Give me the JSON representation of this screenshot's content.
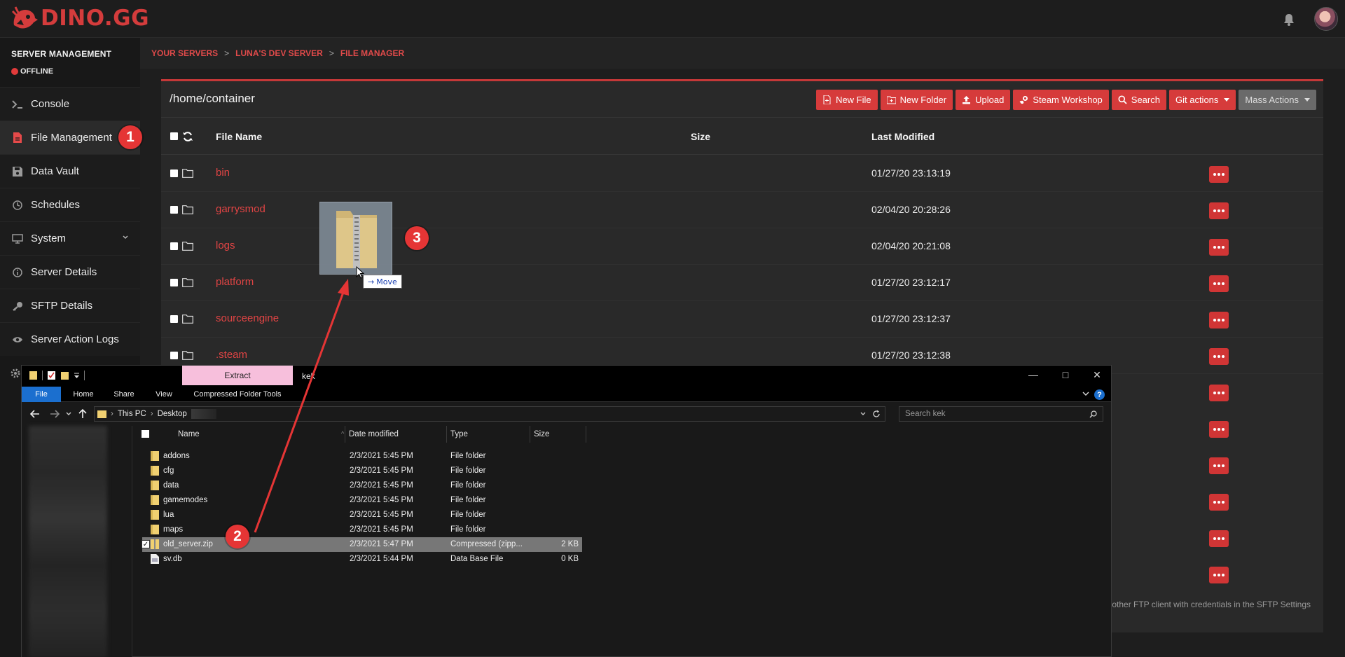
{
  "brand": {
    "name": "DINO.GG",
    "accent": "#d43c3c"
  },
  "sidebar": {
    "title": "SERVER MANAGEMENT",
    "status": "OFFLINE",
    "items": [
      {
        "label": "Console",
        "icon": "terminal-icon"
      },
      {
        "label": "File Management",
        "icon": "file-icon"
      },
      {
        "label": "Data Vault",
        "icon": "floppy-icon"
      },
      {
        "label": "Schedules",
        "icon": "clock-icon"
      },
      {
        "label": "System",
        "icon": "monitor-icon"
      },
      {
        "label": "Server Details",
        "icon": "info-icon"
      },
      {
        "label": "SFTP Details",
        "icon": "key-icon"
      },
      {
        "label": "Server Action Logs",
        "icon": "eye-icon"
      }
    ]
  },
  "breadcrumb": {
    "items": [
      "YOUR SERVERS",
      "LUNA'S DEV SERVER",
      "FILE MANAGER"
    ],
    "sep": ">"
  },
  "file_manager": {
    "path": "/home/container",
    "toolbar": {
      "new_file": "New File",
      "new_folder": "New Folder",
      "upload": "Upload",
      "steam_workshop": "Steam Workshop",
      "search": "Search",
      "git_actions": "Git actions",
      "mass_actions": "Mass Actions"
    },
    "columns": {
      "name": "File Name",
      "size": "Size",
      "modified": "Last Modified"
    },
    "rows": [
      {
        "name": "bin",
        "modified": "01/27/20 23:13:19"
      },
      {
        "name": "garrysmod",
        "modified": "02/04/20 20:28:26"
      },
      {
        "name": "logs",
        "modified": "02/04/20 20:21:08"
      },
      {
        "name": "platform",
        "modified": "01/27/20 23:12:17"
      },
      {
        "name": "sourceengine",
        "modified": "01/27/20 23:12:37"
      },
      {
        "name": ".steam",
        "modified": "01/27/20 23:12:38"
      }
    ],
    "footer_note": "y other FTP client with credentials in the SFTP Settings"
  },
  "drag": {
    "tooltip": "Move"
  },
  "badges": [
    "1",
    "2",
    "3"
  ],
  "explorer": {
    "title": "kek",
    "extract_tab": "Extract",
    "ribbon_tabs": [
      "File",
      "Home",
      "Share",
      "View",
      "Compressed Folder Tools"
    ],
    "address": [
      "This PC",
      "Desktop"
    ],
    "search_placeholder": "Search kek",
    "columns": {
      "name": "Name",
      "date": "Date modified",
      "type": "Type",
      "size": "Size"
    },
    "files": [
      {
        "name": "addons",
        "date": "2/3/2021 5:45 PM",
        "type": "File folder",
        "size": ""
      },
      {
        "name": "cfg",
        "date": "2/3/2021 5:45 PM",
        "type": "File folder",
        "size": ""
      },
      {
        "name": "data",
        "date": "2/3/2021 5:45 PM",
        "type": "File folder",
        "size": ""
      },
      {
        "name": "gamemodes",
        "date": "2/3/2021 5:45 PM",
        "type": "File folder",
        "size": ""
      },
      {
        "name": "lua",
        "date": "2/3/2021 5:45 PM",
        "type": "File folder",
        "size": ""
      },
      {
        "name": "maps",
        "date": "2/3/2021 5:45 PM",
        "type": "File folder",
        "size": ""
      },
      {
        "name": "old_server.zip",
        "date": "2/3/2021 5:47 PM",
        "type": "Compressed (zipp...",
        "size": "2 KB"
      },
      {
        "name": "sv.db",
        "date": "2/3/2021 5:44 PM",
        "type": "Data Base File",
        "size": "0 KB"
      }
    ]
  }
}
